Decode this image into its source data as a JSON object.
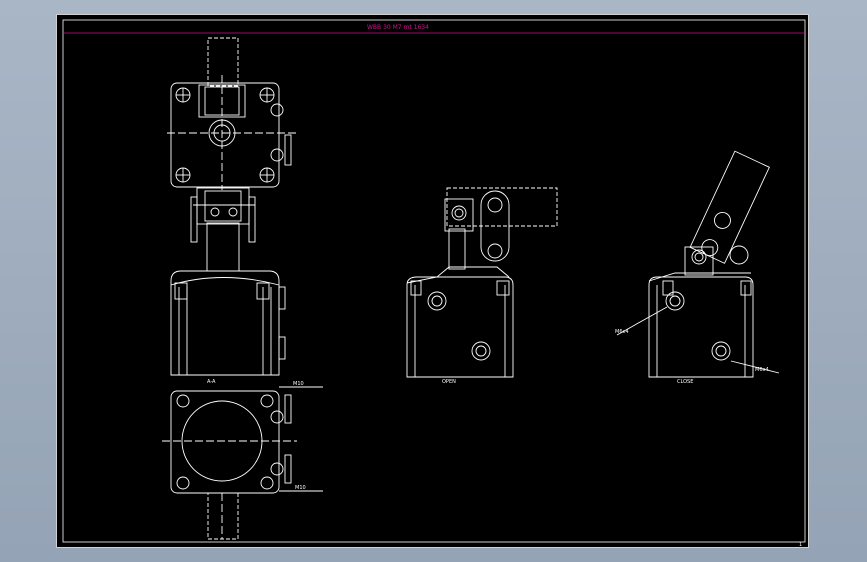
{
  "sheet": {
    "title_text": "WBB 30 M7  mt 1634",
    "page_number": "1"
  },
  "views": {
    "top_view": {
      "label": "A-A"
    },
    "front_view": {
      "label": "OPEN"
    },
    "side_view": {
      "label": "CLOSE"
    },
    "bottom_view": {
      "label": ""
    }
  },
  "annotations": {
    "bottom_hole_top": "M10",
    "bottom_hole_bottom": "M10",
    "side_left": "M6x4",
    "side_right": "M6x4"
  },
  "colors": {
    "background": "#000000",
    "line": "#ffffff",
    "title": "#d01090",
    "outer_bg": "#a9b6c6"
  }
}
